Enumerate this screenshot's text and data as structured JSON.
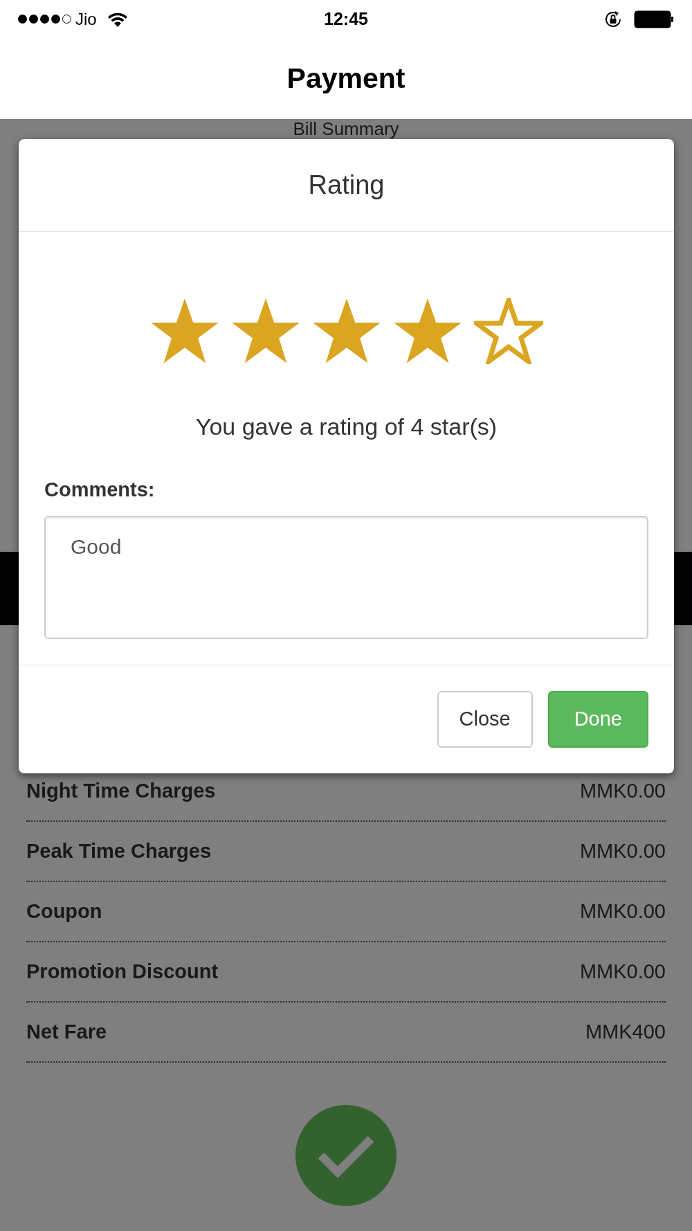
{
  "status_bar": {
    "carrier": "Jio",
    "time": "12:45"
  },
  "header": {
    "title": "Payment"
  },
  "bill_summary": {
    "title": "Bill Summary",
    "rows": [
      {
        "label": "Night Time Charges",
        "value": "MMK0.00"
      },
      {
        "label": "Peak Time Charges",
        "value": "MMK0.00"
      },
      {
        "label": "Coupon",
        "value": "MMK0.00"
      },
      {
        "label": "Promotion Discount",
        "value": "MMK0.00"
      },
      {
        "label": "Net Fare",
        "value": "MMK400"
      }
    ]
  },
  "rating_dialog": {
    "title": "Rating",
    "stars": 4,
    "rating_text": "You gave a rating of 4 star(s)",
    "comments_label": "Comments:",
    "comments": "Good",
    "buttons": [
      {
        "label": "Close",
        "kind": "secondary"
      },
      {
        "label": "Done",
        "kind": "primary"
      }
    ]
  }
}
